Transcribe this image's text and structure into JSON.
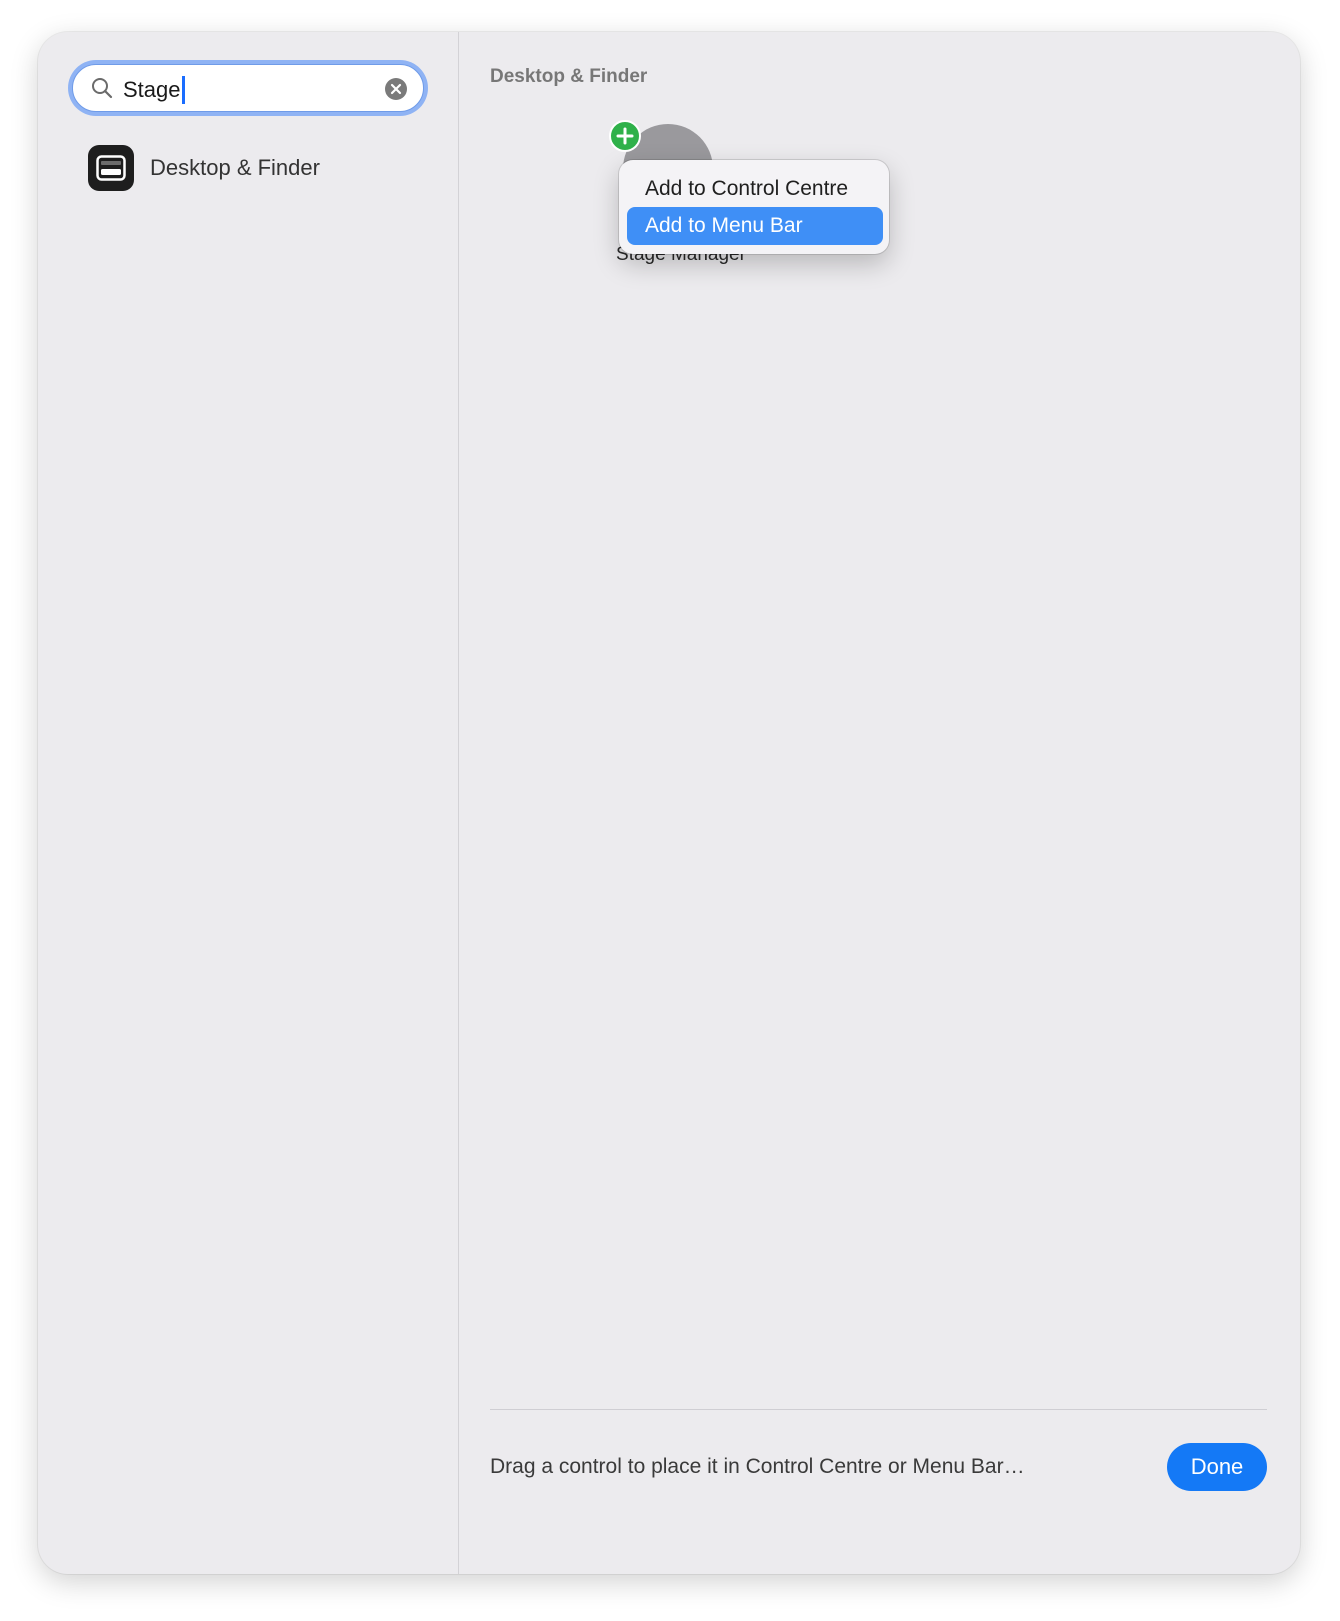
{
  "search": {
    "value": "Stage",
    "icon": "magnifying-glass-icon",
    "clear_icon": "x-circle-icon"
  },
  "sidebar": {
    "results": [
      {
        "label": "Desktop & Finder",
        "icon": "desktop-window-icon"
      }
    ]
  },
  "main": {
    "section_title": "Desktop & Finder",
    "controls": [
      {
        "label": "Stage Manager",
        "badge_icon": "plus-icon"
      }
    ],
    "context_menu": {
      "items": [
        {
          "label": "Add to Control Centre"
        },
        {
          "label": "Add to Menu Bar",
          "highlighted": true
        }
      ]
    }
  },
  "footer": {
    "hint": "Drag a control to place it in Control Centre or Menu Bar…",
    "done_label": "Done"
  },
  "colors": {
    "accent": "#1479f6",
    "highlight": "#3f8ff6",
    "add_badge": "#2fb14a",
    "window_bg": "#ecebee"
  }
}
